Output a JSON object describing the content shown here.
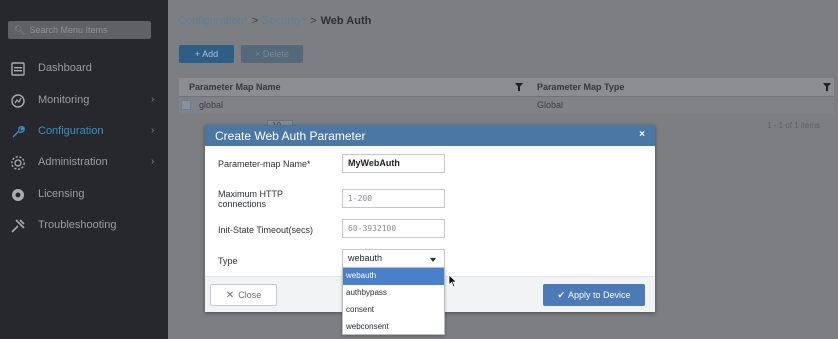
{
  "sidebar": {
    "search_placeholder": "Search Menu Items",
    "items": [
      {
        "label": "Dashboard",
        "icon": "dashboard-icon",
        "has_chevron": false
      },
      {
        "label": "Monitoring",
        "icon": "monitoring-icon",
        "has_chevron": true
      },
      {
        "label": "Configuration",
        "icon": "configuration-icon",
        "has_chevron": true,
        "active": true
      },
      {
        "label": "Administration",
        "icon": "administration-icon",
        "has_chevron": true
      },
      {
        "label": "Licensing",
        "icon": "licensing-icon",
        "has_chevron": false
      },
      {
        "label": "Troubleshooting",
        "icon": "troubleshooting-icon",
        "has_chevron": false
      }
    ]
  },
  "breadcrumb": {
    "items": [
      "Configuration",
      "Security"
    ],
    "separator": ">",
    "current": "Web Auth"
  },
  "toolbar": {
    "add_label": "+ Add",
    "delete_label": "× Delete"
  },
  "table": {
    "columns": [
      "Parameter Map Name",
      "Parameter Map Type"
    ],
    "rows": [
      {
        "name": "global",
        "type": "Global"
      }
    ],
    "page_size": "10",
    "items_count": "1 - 1 of 1 items"
  },
  "modal": {
    "title": "Create Web Auth Parameter",
    "close_symbol": "×",
    "fields": {
      "name_label": "Parameter-map Name*",
      "name_value": "MyWebAuth",
      "max_http_label": "Maximum HTTP connections",
      "max_http_placeholder": "1-200",
      "timeout_label": "Init-State Timeout(secs)",
      "timeout_placeholder": "60-3932100",
      "type_label": "Type",
      "type_value": "webauth"
    },
    "type_options": [
      "webauth",
      "authbypass",
      "consent",
      "webconsent"
    ],
    "selected_option": "webauth",
    "close_button_label": "Close",
    "apply_button_label": "Apply to Device"
  },
  "colors": {
    "accent": "#4b77a5",
    "active_nav": "#3d8fc4",
    "dropdown_selected": "#4a7fc9"
  }
}
